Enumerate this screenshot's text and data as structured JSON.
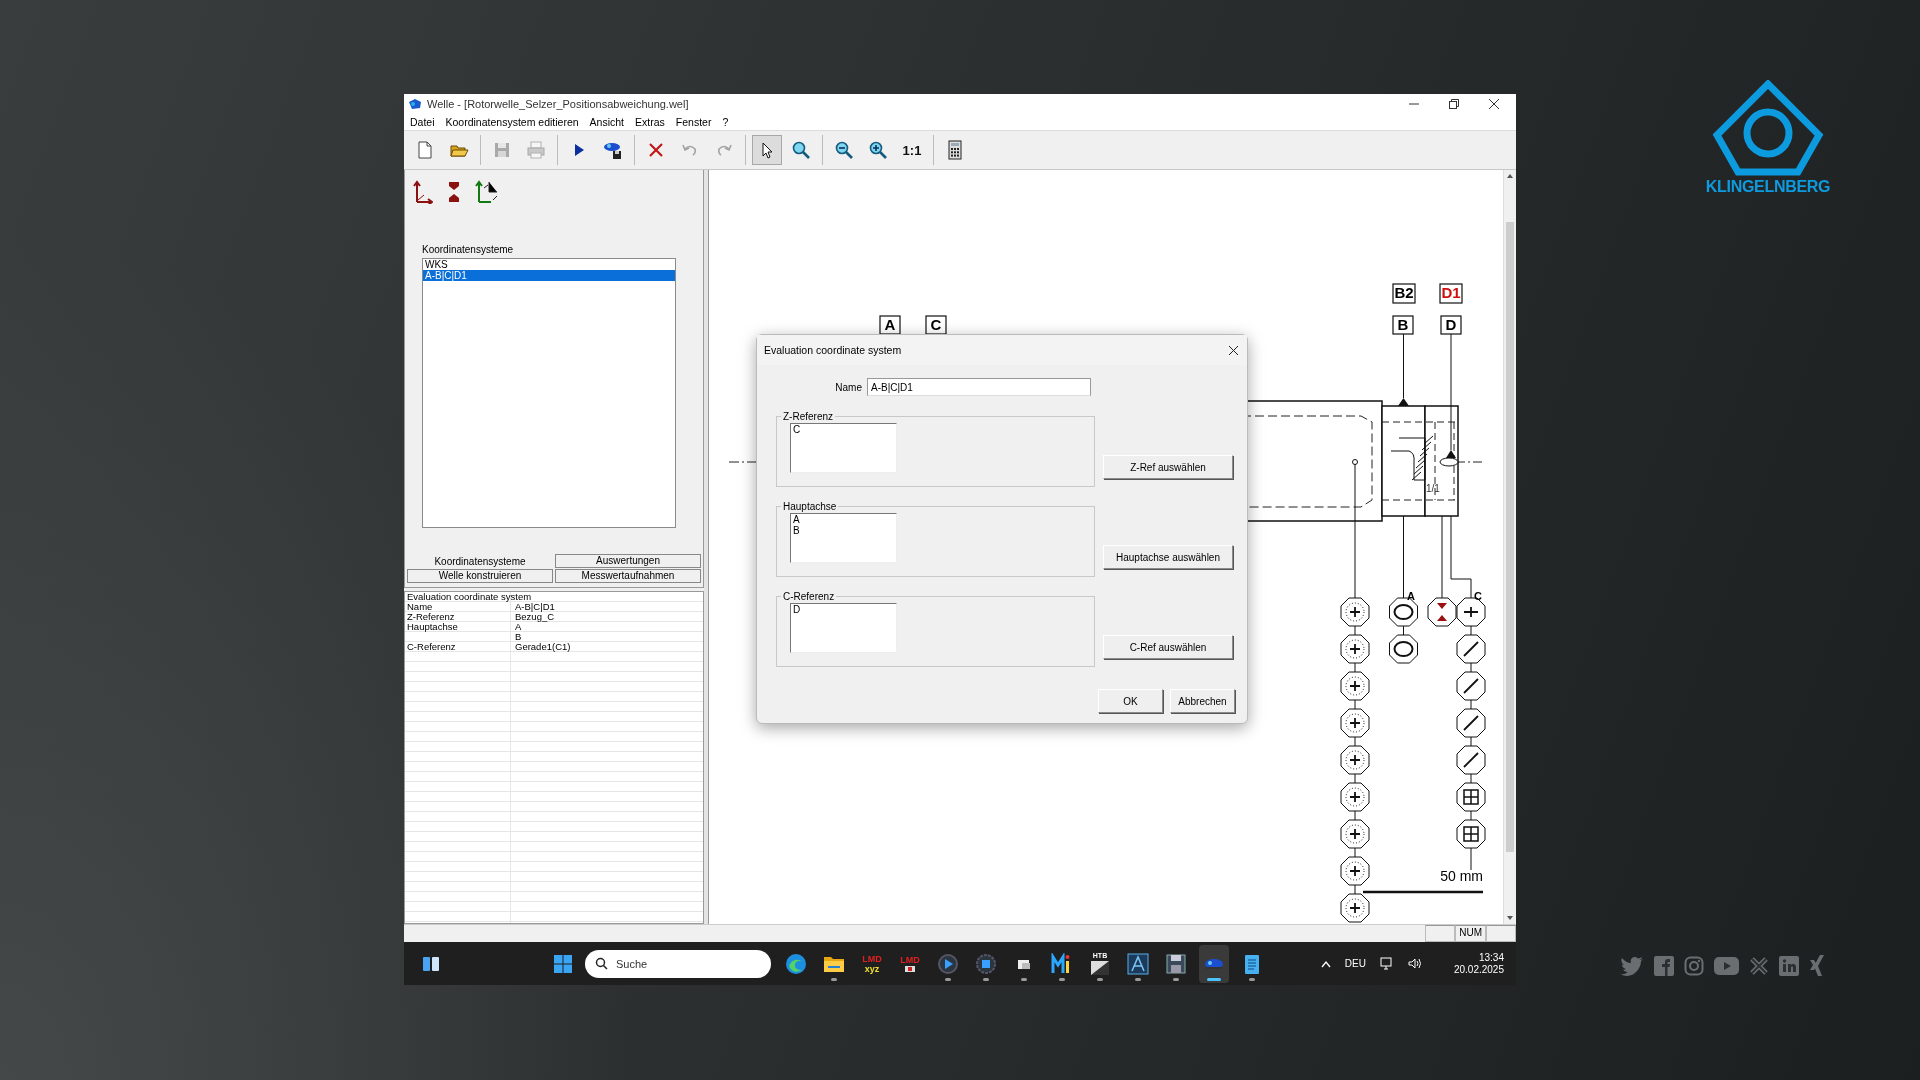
{
  "window": {
    "title": "Welle - [Rotorwelle_Selzer_Positionsabweichung.wel]"
  },
  "menu": [
    "Datei",
    "Koordinatensystem editieren",
    "Ansicht",
    "Extras",
    "Fenster",
    "?"
  ],
  "toolbar": [
    {
      "kind": "new",
      "disabled": false,
      "selected": false
    },
    {
      "kind": "open",
      "disabled": false,
      "selected": false
    },
    {
      "kind": "separator"
    },
    {
      "kind": "save",
      "disabled": true,
      "selected": false
    },
    {
      "kind": "print",
      "disabled": true,
      "selected": false
    },
    {
      "kind": "separator"
    },
    {
      "kind": "run",
      "disabled": false,
      "selected": false
    },
    {
      "kind": "machine",
      "disabled": false,
      "selected": false
    },
    {
      "kind": "separator"
    },
    {
      "kind": "delete",
      "disabled": false,
      "selected": false
    },
    {
      "kind": "undo",
      "disabled": true,
      "selected": false
    },
    {
      "kind": "redo",
      "disabled": true,
      "selected": false
    },
    {
      "kind": "separator"
    },
    {
      "kind": "pointer",
      "disabled": false,
      "selected": true
    },
    {
      "kind": "zoom",
      "disabled": false,
      "selected": false
    },
    {
      "kind": "separator"
    },
    {
      "kind": "zoom-out",
      "disabled": false,
      "selected": false
    },
    {
      "kind": "zoom-in",
      "disabled": false,
      "selected": false
    },
    {
      "kind": "text",
      "label": "1:1",
      "disabled": false,
      "selected": false
    },
    {
      "kind": "separator"
    },
    {
      "kind": "calculator",
      "disabled": false,
      "selected": false
    }
  ],
  "left_panel": {
    "tools": [
      {
        "kind": "axis"
      },
      {
        "kind": "hourglass"
      },
      {
        "kind": "axes"
      }
    ],
    "list_label": "Koordinatensysteme",
    "list": [
      {
        "label": "WKS",
        "selected": false
      },
      {
        "label": "A-B|C|D1",
        "selected": true
      }
    ],
    "tab_rows": [
      {
        "tabs": [
          {
            "label": "Koordinatensysteme",
            "selected": true
          },
          {
            "label": "Auswertungen",
            "selected": false
          }
        ]
      },
      {
        "tabs": [
          {
            "label": "Welle konstruieren",
            "selected": false
          },
          {
            "label": "Messwertaufnahmen",
            "selected": false
          }
        ]
      }
    ],
    "properties": [
      {
        "kind": "header",
        "name": "Evaluation coordinate system"
      },
      {
        "kind": "row",
        "name": "Name",
        "value": "A-B|C|D1"
      },
      {
        "kind": "row",
        "name": "Z-Referenz",
        "value": "Bezug_C"
      },
      {
        "kind": "row",
        "name": "Hauptachse",
        "value": "A"
      },
      {
        "kind": "row",
        "value": "B"
      },
      {
        "kind": "row",
        "name": "C-Referenz",
        "value": "Gerade1(C1)"
      }
    ]
  },
  "canvas": {
    "datum_labels": [
      {
        "text": "B2",
        "color": "#000000"
      },
      {
        "text": "D1",
        "color": "#d01010"
      },
      {
        "text": "A",
        "color": "#000000"
      },
      {
        "text": "C",
        "color": "#000000"
      },
      {
        "text": "B",
        "color": "#000000"
      },
      {
        "text": "D",
        "color": "#000000"
      }
    ],
    "section_label": "1/1",
    "column_labels": [
      "A",
      "C"
    ],
    "scale_label": "50 mm"
  },
  "dialog": {
    "title": "Evaluation coordinate system",
    "name_label": "Name",
    "name_value": "A-B|C|D1",
    "groups": [
      {
        "label": "Z-Referenz",
        "items": [
          "C"
        ],
        "button": "Z-Ref auswählen"
      },
      {
        "label": "Hauptachse",
        "items": [
          "A",
          "B"
        ],
        "button": "Hauptachse auswählen"
      },
      {
        "label": "C-Referenz",
        "items": [
          "D"
        ],
        "button": "C-Ref auswählen"
      }
    ],
    "buttons": [
      "OK",
      "Abbrechen"
    ]
  },
  "status_bar": {
    "indicator": "NUM"
  },
  "taskbar": {
    "placeholder": "Suche",
    "apps": [
      {
        "kind": "edge",
        "running": false,
        "selected": false
      },
      {
        "kind": "folder",
        "running": true,
        "selected": false
      },
      {
        "kind": "lmd",
        "label": "LMD",
        "sublabel": "xyz",
        "running": false,
        "selected": false
      },
      {
        "kind": "lmd",
        "label": "LMD",
        "running": false,
        "selected": false
      },
      {
        "kind": "play",
        "running": true,
        "selected": false
      },
      {
        "kind": "stop",
        "running": true,
        "selected": false
      },
      {
        "kind": "files",
        "running": true,
        "selected": false
      },
      {
        "kind": "bars",
        "running": true,
        "selected": false
      },
      {
        "kind": "lmd-dark",
        "label": "HTB",
        "running": true,
        "selected": false
      },
      {
        "kind": "triangle",
        "running": true,
        "selected": false
      },
      {
        "kind": "floppy",
        "running": true,
        "selected": false
      },
      {
        "kind": "machine",
        "running": true,
        "selected": true
      },
      {
        "kind": "notepad",
        "running": true,
        "selected": false
      }
    ],
    "language": "DEU",
    "time": "13:34",
    "date": "20.02.2025"
  },
  "brand": {
    "name": "KLINGELNBERG"
  }
}
